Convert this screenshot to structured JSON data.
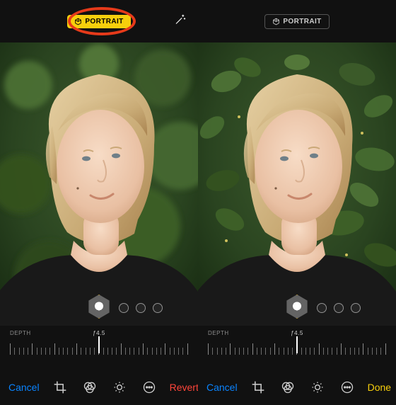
{
  "left": {
    "portrait_label": "PORTRAIT",
    "portrait_active": true,
    "wand_visible": true,
    "depth_label": "DEPTH",
    "aperture": "ƒ4.5",
    "cancel": "Cancel",
    "right_action": "Revert",
    "right_action_class": "c-revert"
  },
  "right": {
    "portrait_label": "PORTRAIT",
    "portrait_active": false,
    "wand_visible": false,
    "depth_label": "DEPTH",
    "aperture": "ƒ4.5",
    "cancel": "Cancel",
    "right_action": "Done",
    "right_action_class": "c-done"
  },
  "toolbar_icons": [
    "crop-icon",
    "filters-icon",
    "light-icon",
    "more-icon"
  ]
}
